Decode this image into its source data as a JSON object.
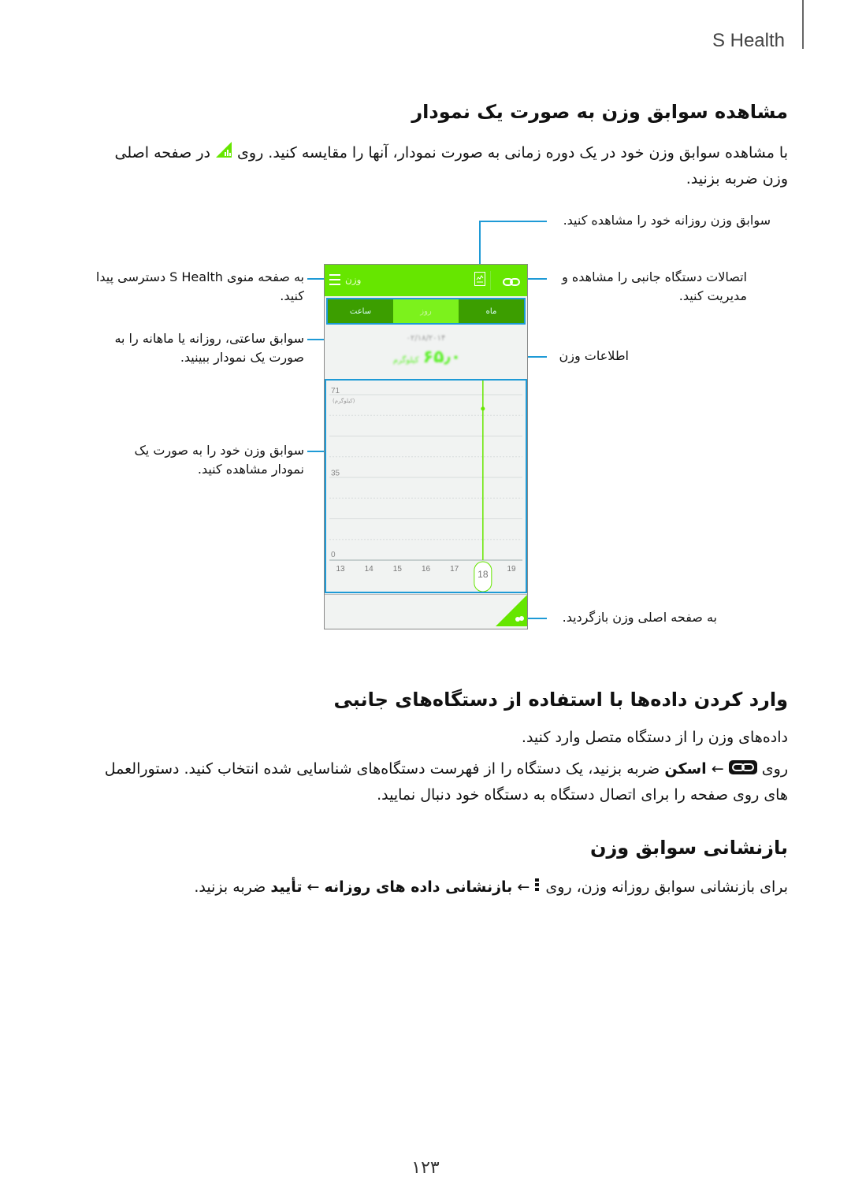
{
  "header": {
    "app_title": "S Health"
  },
  "section1": {
    "title": "مشاهده سوابق وزن به صورت یک نمودار",
    "body_line1_a": "با مشاهده سوابق وزن خود در یک دوره زمانی به صورت نمودار، آنها را مقایسه کنید. روی",
    "body_line1_b": "در صفحه اصلی",
    "body_line2": "وزن ضربه بزنید."
  },
  "phone": {
    "topbar_title": "وزن",
    "tabs": [
      {
        "label": "ساعت",
        "selected": false
      },
      {
        "label": "روز",
        "selected": true
      },
      {
        "label": "ماه",
        "selected": false
      }
    ],
    "date": "۰۲/۱۸/۲۰۱۴",
    "weight_value": "۶۵٫۰",
    "weight_unit": "کیلوگرم",
    "colors": {
      "accent": "#66e600",
      "tab_dark": "#3c9e00",
      "tab_selected": "#7cf21c",
      "callout": "#1e9ad6"
    }
  },
  "chart_data": {
    "type": "line",
    "title": "",
    "xlabel": "",
    "ylabel": "(کیلوگرم)",
    "x": [
      "13",
      "14",
      "15",
      "16",
      "17",
      "18",
      "19"
    ],
    "series": [
      {
        "name": "وزن",
        "values": [
          null,
          null,
          null,
          null,
          null,
          65,
          null
        ]
      }
    ],
    "ylim": [
      0,
      71
    ],
    "y_ticks": [
      "71",
      "35",
      "0"
    ],
    "selected_x": "18",
    "grid": true
  },
  "callouts": {
    "daily_records": "سوابق وزن روزانه خود را مشاهده کنید.",
    "connections_l1": "اتصالات دستگاه جانبی را مشاهده و",
    "connections_l2": "مدیریت کنید.",
    "weight_info": "اطلاعات وزن",
    "menu_l1": "به صفحه منوی S Health دسترسی پیدا",
    "menu_l2": "کنید.",
    "periods_l1": "سوابق ساعتی، روزانه یا ماهانه را به",
    "periods_l2": "صورت یک نمودار ببینید.",
    "graph_l1": "سوابق وزن خود را به صورت یک",
    "graph_l2": "نمودار مشاهده کنید.",
    "back_main": "به صفحه اصلی وزن بازگردید."
  },
  "section2": {
    "title": "وارد کردن داده‌ها با استفاده از دستگاه‌های جانبی",
    "intro": "داده‌های وزن را از دستگاه متصل وارد کنید.",
    "step_a": "روی",
    "step_arrow": "←",
    "step_scan": "اسکن",
    "step_b": "ضربه بزنید، یک دستگاه را از فهرست دستگاه‌های شناسایی شده انتخاب کنید. دستورالعمل",
    "step_line2": "های روی صفحه را برای اتصال دستگاه به دستگاه خود دنبال نمایید."
  },
  "section3": {
    "title": "بازنشانی سوابق وزن",
    "text_a": "برای بازنشانی سوابق روزانه وزن، روی",
    "arrow": "←",
    "reset_daily": "بازنشانی داده های روزانه",
    "confirm": "تأیید",
    "text_b": "ضربه بزنید."
  },
  "footer": {
    "page_number": "۱۲۳"
  }
}
